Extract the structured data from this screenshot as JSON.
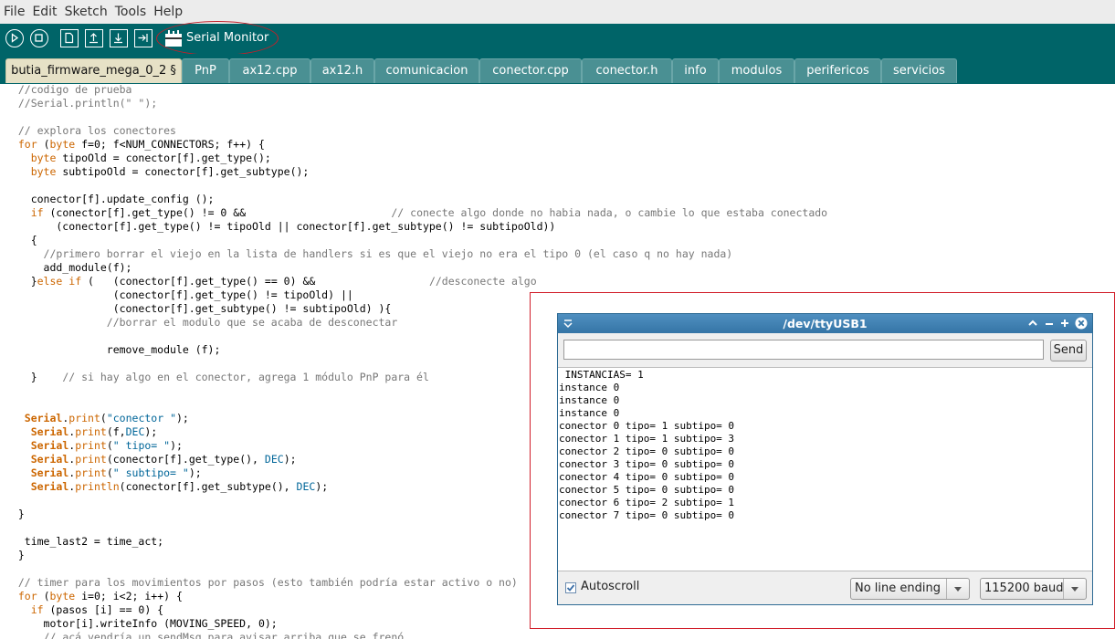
{
  "menu": [
    "File",
    "Edit",
    "Sketch",
    "Tools",
    "Help"
  ],
  "toolbar": {
    "buttons": [
      "verify-icon",
      "stop-icon",
      "new-icon",
      "open-icon",
      "save-icon",
      "upload-icon"
    ],
    "serial_monitor_label": "Serial Monitor"
  },
  "tabs": [
    "butia_firmware_mega_0_2 §",
    "PnP",
    "ax12.cpp",
    "ax12.h",
    "comunicacion",
    "conector.cpp",
    "conector.h",
    "info",
    "modulos",
    "perifericos",
    "servicios"
  ],
  "code_lines": [
    "  //codigo de prueba",
    "  //Serial.println(\" \");",
    "",
    "  // explora los conectores",
    "  for (byte f=0; f<NUM_CONNECTORS; f++) {",
    "    byte tipoOld = conector[f].get_type();",
    "    byte subtipoOld = conector[f].get_subtype();",
    "",
    "    conector[f].update_config ();",
    "    if (conector[f].get_type() != 0 &&                       // conecte algo donde no habia nada, o cambie lo que estaba conectado",
    "        (conector[f].get_type() != tipoOld || conector[f].get_subtype() != subtipoOld))",
    "    {",
    "      //primero borrar el viejo en la lista de handlers si es que el viejo no era el tipo 0 (el caso q no hay nada)",
    "      add_module(f);",
    "    }else if (   (conector[f].get_type() == 0) &&                  //desconecte algo",
    "                 (conector[f].get_type() != tipoOld) ||",
    "                 (conector[f].get_subtype() != subtipoOld) ){",
    "                //borrar el modulo que se acaba de desconectar",
    "",
    "                remove_module (f);",
    "",
    "    }    // si hay algo en el conector, agrega 1 módulo PnP para él",
    "",
    "",
    "   Serial.print(\"conector \");",
    "    Serial.print(f,DEC);",
    "    Serial.print(\" tipo= \");",
    "    Serial.print(conector[f].get_type(), DEC);",
    "    Serial.print(\" subtipo= \");",
    "    Serial.println(conector[f].get_subtype(), DEC);",
    "",
    "  }",
    "",
    "   time_last2 = time_act;",
    "  }",
    "",
    "  // timer para los movimientos por pasos (esto también podría estar activo o no)",
    "  for (byte i=0; i<2; i++) {",
    "    if (pasos [i] == 0) {",
    "      motor[i].writeInfo (MOVING_SPEED, 0);",
    "      // acá vendría un sendMsg para avisar arriba que se frenó"
  ],
  "serial_monitor": {
    "title": "/dev/ttyUSB1",
    "input_value": "",
    "send_label": "Send",
    "output_lines": [
      " INSTANCIAS= 1",
      "instance 0",
      "instance 0",
      "instance 0",
      "conector 0 tipo= 1 subtipo= 0",
      "conector 1 tipo= 1 subtipo= 3",
      "conector 2 tipo= 0 subtipo= 0",
      "conector 3 tipo= 0 subtipo= 0",
      "conector 4 tipo= 0 subtipo= 0",
      "conector 5 tipo= 0 subtipo= 0",
      "conector 6 tipo= 2 subtipo= 1",
      "conector 7 tipo= 0 subtipo= 0"
    ],
    "autoscroll_label": "Autoscroll",
    "autoscroll_checked": true,
    "line_ending": "No line ending",
    "baud": "115200 baud"
  },
  "colors": {
    "toolbar": "#006468",
    "tab": "#4a9093",
    "active_tab": "#e6e1c6",
    "annotation": "#d11e2a",
    "keyword": "#cc6600",
    "string": "#006699",
    "comment": "#777777"
  }
}
